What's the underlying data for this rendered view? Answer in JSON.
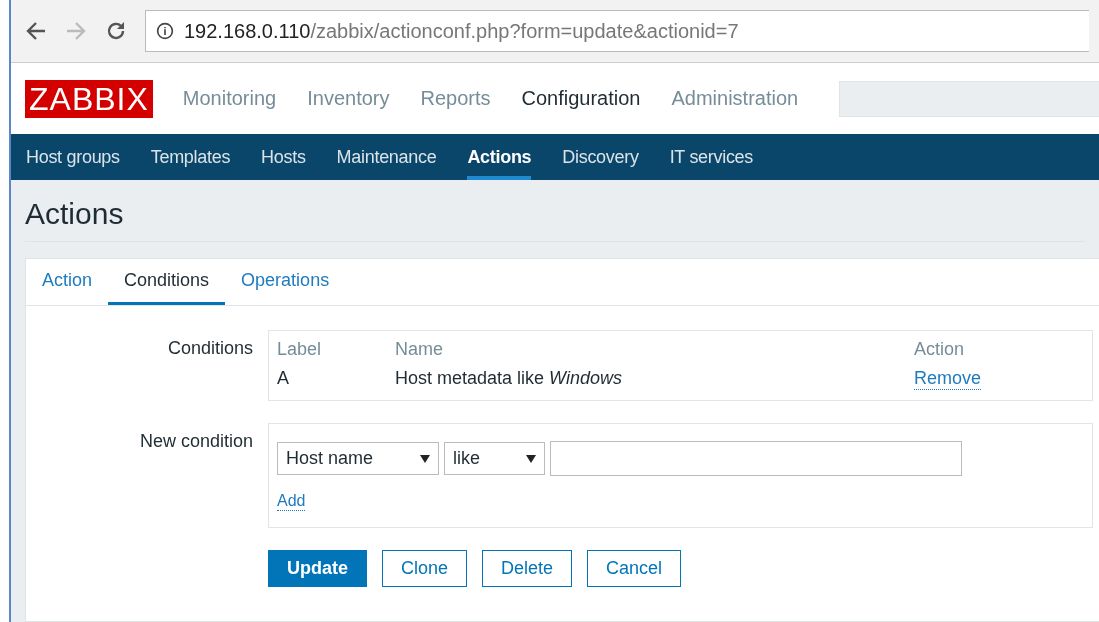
{
  "browser": {
    "url": {
      "host": "192.168.0.110",
      "path": "/zabbix/actionconf.php?form=update&actionid=7"
    }
  },
  "logo": "ZABBIX",
  "main_menu": [
    {
      "label": "Monitoring",
      "selected": false
    },
    {
      "label": "Inventory",
      "selected": false
    },
    {
      "label": "Reports",
      "selected": false
    },
    {
      "label": "Configuration",
      "selected": true
    },
    {
      "label": "Administration",
      "selected": false
    }
  ],
  "sub_menu": [
    {
      "label": "Host groups",
      "selected": false
    },
    {
      "label": "Templates",
      "selected": false
    },
    {
      "label": "Hosts",
      "selected": false
    },
    {
      "label": "Maintenance",
      "selected": false
    },
    {
      "label": "Actions",
      "selected": true
    },
    {
      "label": "Discovery",
      "selected": false
    },
    {
      "label": "IT services",
      "selected": false
    }
  ],
  "page_title": "Actions",
  "tabs": [
    {
      "label": "Action",
      "selected": false
    },
    {
      "label": "Conditions",
      "selected": true
    },
    {
      "label": "Operations",
      "selected": false
    }
  ],
  "conditions": {
    "label": "Conditions",
    "columns": [
      "Label",
      "Name",
      "Action"
    ],
    "rows": [
      {
        "label": "A",
        "name": "Host metadata like *Windows*",
        "action": "Remove"
      }
    ]
  },
  "new_condition": {
    "label": "New condition",
    "type_select": "Host name",
    "operator_select": "like",
    "add": "Add"
  },
  "buttons": [
    {
      "label": "Update",
      "kind": "primary"
    },
    {
      "label": "Clone",
      "kind": "secondary"
    },
    {
      "label": "Delete",
      "kind": "secondary"
    },
    {
      "label": "Cancel",
      "kind": "secondary"
    }
  ]
}
